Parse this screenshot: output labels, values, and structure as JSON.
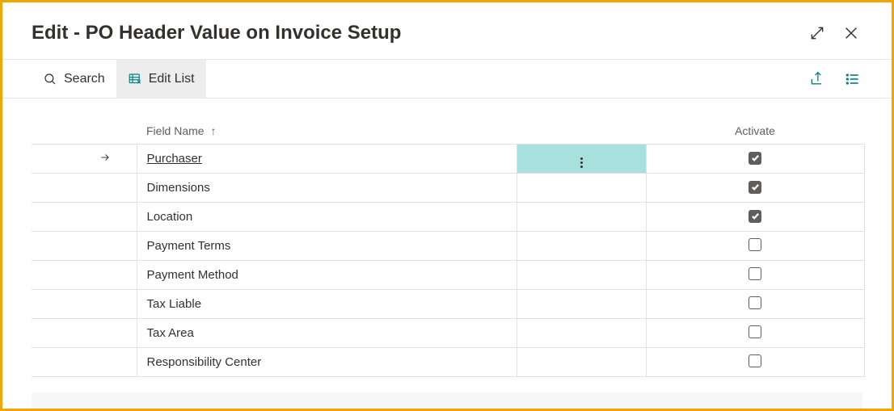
{
  "header": {
    "title": "Edit - PO Header Value on Invoice Setup"
  },
  "toolbar": {
    "search_label": "Search",
    "edit_list_label": "Edit List"
  },
  "table": {
    "columns": {
      "field_name": "Field Name",
      "activate": "Activate"
    },
    "rows": [
      {
        "field_name": "Purchaser",
        "activate": true,
        "selected": true
      },
      {
        "field_name": "Dimensions",
        "activate": true
      },
      {
        "field_name": "Location",
        "activate": true
      },
      {
        "field_name": "Payment Terms",
        "activate": false
      },
      {
        "field_name": "Payment Method",
        "activate": false
      },
      {
        "field_name": "Tax Liable",
        "activate": false
      },
      {
        "field_name": "Tax Area",
        "activate": false
      },
      {
        "field_name": "Responsibility Center",
        "activate": false
      }
    ]
  }
}
